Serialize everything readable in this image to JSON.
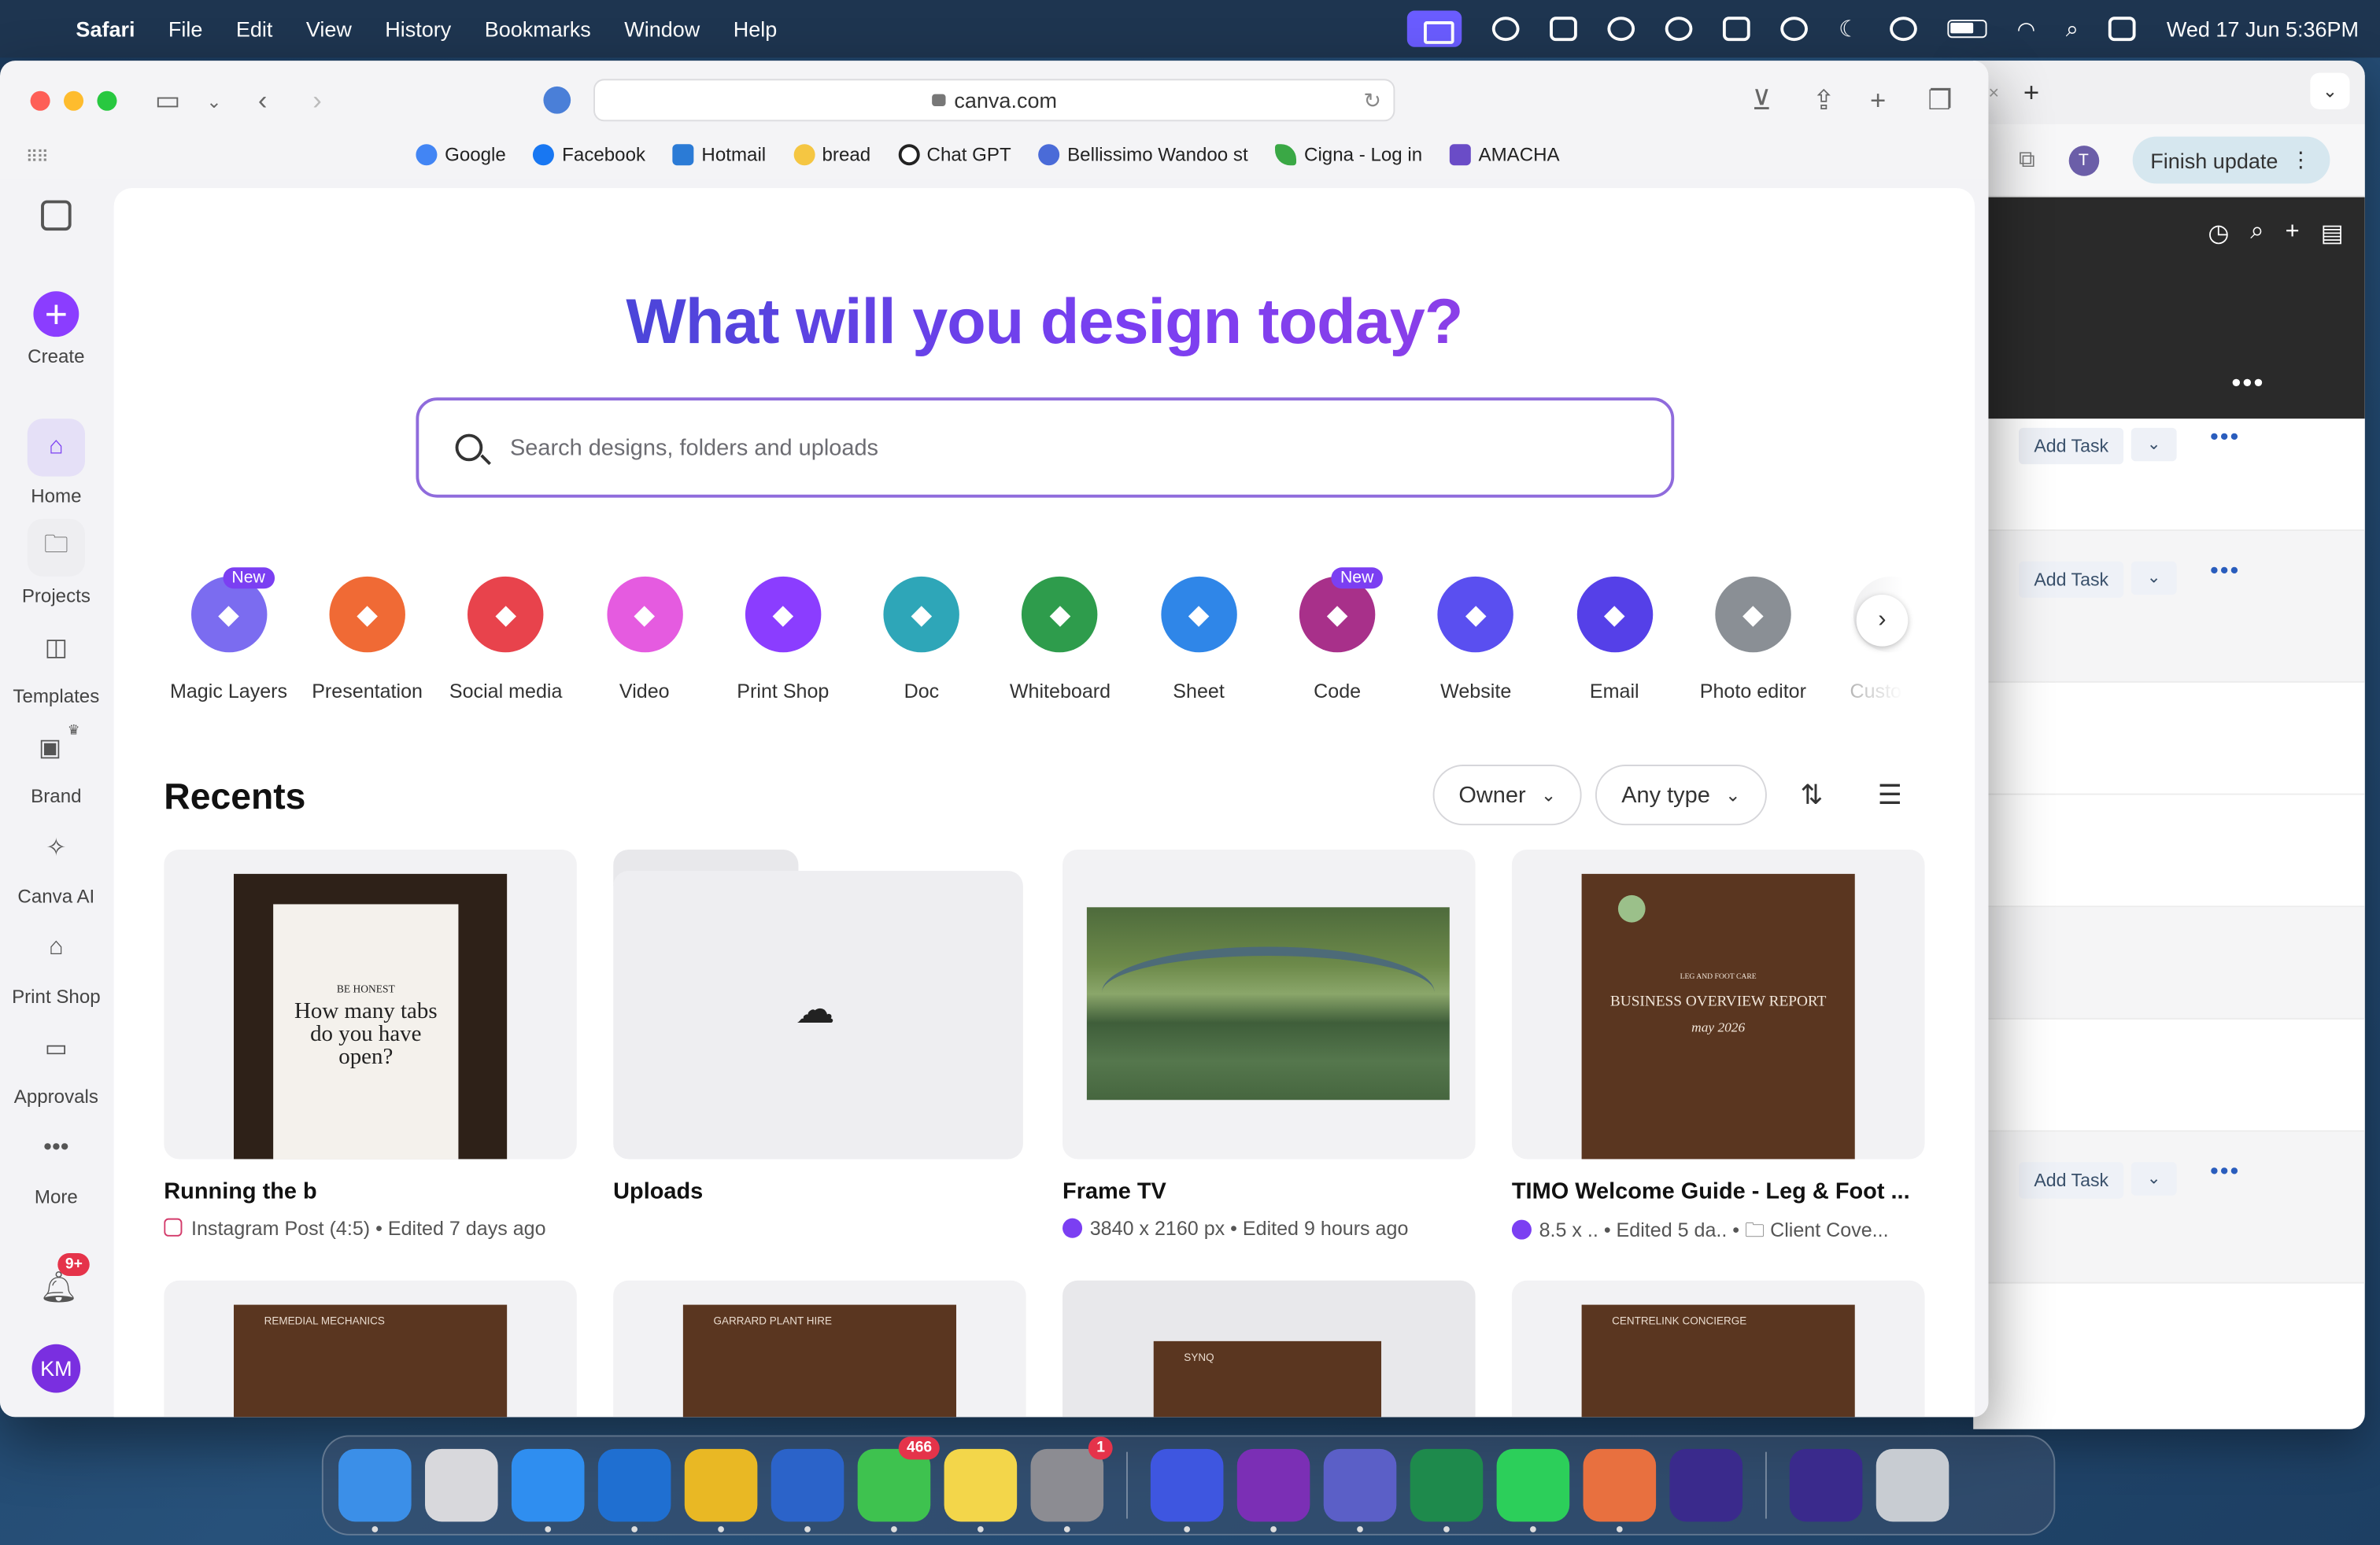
{
  "menubar": {
    "app": "Safari",
    "items": [
      "File",
      "Edit",
      "View",
      "History",
      "Bookmarks",
      "Window",
      "Help"
    ],
    "clock": "Wed 17 Jun  5:36PM"
  },
  "browser": {
    "url": "canva.com",
    "bookmarks": [
      {
        "label": "Google",
        "color": "#4285f4"
      },
      {
        "label": "Facebook",
        "color": "#1877f2"
      },
      {
        "label": "Hotmail",
        "color": "#2b7bd6"
      },
      {
        "label": "bread",
        "color": "#f5c642"
      },
      {
        "label": "Chat GPT",
        "color": "#222222"
      },
      {
        "label": "Bellissimo Wandoo st",
        "color": "#4a6bd8"
      },
      {
        "label": "Cigna - Log in",
        "color": "#3aa845"
      },
      {
        "label": "AMACHA",
        "color": "#6a4cc7"
      }
    ]
  },
  "bg_window": {
    "avatar": "T",
    "finish_update": "Finish update",
    "add_task": "Add Task"
  },
  "sidebar": {
    "create": "Create",
    "items": [
      {
        "label": "Home",
        "icon": "home-icon"
      },
      {
        "label": "Projects",
        "icon": "folder-icon"
      },
      {
        "label": "Templates",
        "icon": "templates-icon"
      },
      {
        "label": "Brand",
        "icon": "brand-icon"
      },
      {
        "label": "Canva AI",
        "icon": "canva-ai-icon"
      },
      {
        "label": "Print Shop",
        "icon": "print-shop-icon"
      },
      {
        "label": "Approvals",
        "icon": "approvals-icon"
      },
      {
        "label": "More",
        "icon": "more-icon"
      }
    ],
    "notifications_badge": "9+",
    "avatar": "KM"
  },
  "main": {
    "headline": "What will you design today?",
    "search_placeholder": "Search designs, folders and uploads",
    "categories": [
      {
        "label": "Magic Layers",
        "color": "#7b6cf0",
        "badge": "New"
      },
      {
        "label": "Presentation",
        "color": "#f06a35",
        "badge": ""
      },
      {
        "label": "Social media",
        "color": "#e8434c",
        "badge": ""
      },
      {
        "label": "Video",
        "color": "#e55be0",
        "badge": ""
      },
      {
        "label": "Print Shop",
        "color": "#8b3dff",
        "badge": ""
      },
      {
        "label": "Doc",
        "color": "#2ea6b8",
        "badge": ""
      },
      {
        "label": "Whiteboard",
        "color": "#2e9c4c",
        "badge": ""
      },
      {
        "label": "Sheet",
        "color": "#2f86e8",
        "badge": ""
      },
      {
        "label": "Code",
        "color": "#a8308a",
        "badge": "New"
      },
      {
        "label": "Website",
        "color": "#5a4ff0",
        "badge": ""
      },
      {
        "label": "Email",
        "color": "#5540e8",
        "badge": ""
      },
      {
        "label": "Photo editor",
        "color": "#8a8f95",
        "badge": ""
      },
      {
        "label": "Custom s",
        "color": "#e8e8ea",
        "badge": ""
      }
    ],
    "recents_title": "Recents",
    "filters": {
      "owner": "Owner",
      "type": "Any type"
    },
    "recents": [
      {
        "title": "Running the b",
        "meta": "Instagram Post (4:5) • Edited 7 days ago",
        "thumb_text_small": "BE HONEST",
        "thumb_text": "How many tabs do you have open?"
      },
      {
        "title": "Uploads",
        "meta": ""
      },
      {
        "title": "Frame TV",
        "meta": "3840 x 2160 px • Edited 9 hours ago"
      },
      {
        "title": "TIMO Welcome Guide - Leg & Foot ...",
        "meta": "8.5 x ..  • Edited 5 da..  • 🗀 Client Cove...",
        "thumb_line1": "LEG AND FOOT CARE",
        "thumb_line2": "BUSINESS OVERVIEW REPORT",
        "thumb_line3": "may 2026"
      }
    ],
    "row2_thumbs": [
      "REMEDIAL MECHANICS",
      "GARRARD PLANT HIRE",
      "SYNQ",
      "CENTRELINK CONCIERGE"
    ]
  },
  "dock": {
    "messages_badge": "466",
    "settings_badge": "1",
    "apps": [
      {
        "name": "finder-icon",
        "color": "#3b8fe8"
      },
      {
        "name": "launchpad-icon",
        "color": "#d8d8dc"
      },
      {
        "name": "safari-icon",
        "color": "#2f8ef0"
      },
      {
        "name": "outlook-icon",
        "color": "#1f6fd1"
      },
      {
        "name": "chrome-icon",
        "color": "#e9b824"
      },
      {
        "name": "word-icon",
        "color": "#2b63c9"
      },
      {
        "name": "messages-icon",
        "color": "#3ec24f"
      },
      {
        "name": "notes-icon",
        "color": "#f3d64a"
      },
      {
        "name": "settings-icon",
        "color": "#8c8c92"
      },
      {
        "name": "proton-icon",
        "color": "#3e56e0"
      },
      {
        "name": "onenote-icon",
        "color": "#7b2fb5"
      },
      {
        "name": "teams-icon",
        "color": "#5b5fc7"
      },
      {
        "name": "excel-icon",
        "color": "#1e8a4c"
      },
      {
        "name": "whatsapp-icon",
        "color": "#2ccf5a"
      },
      {
        "name": "claude-icon",
        "color": "#e8703f"
      },
      {
        "name": "grammarly-icon",
        "color": "#3a2a8c"
      },
      {
        "name": "grammarly-doc-icon",
        "color": "#3a2a8c"
      },
      {
        "name": "trash-icon",
        "color": "#c8ccd2"
      }
    ]
  }
}
